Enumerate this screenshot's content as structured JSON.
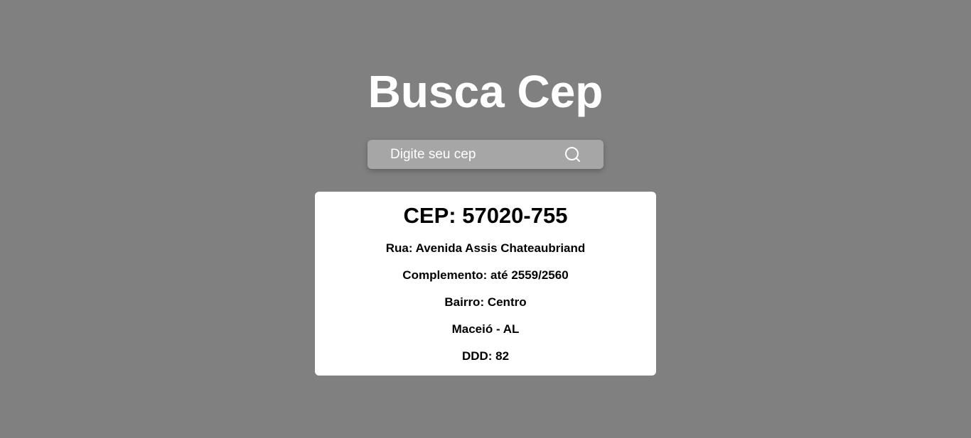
{
  "page": {
    "title": "Busca Cep"
  },
  "search": {
    "placeholder": "Digite seu cep",
    "value": "",
    "button_icon": "search-icon"
  },
  "result": {
    "cep_line": "CEP: 57020-755",
    "rua_line": "Rua: Avenida Assis Chateaubriand",
    "complemento_line": "Complemento: até 2559/2560",
    "bairro_line": "Bairro: Centro",
    "cidade_uf_line": "Maceió - AL",
    "ddd_line": "DDD: 82"
  },
  "colors": {
    "background": "#808080",
    "search_box": "#a6a6a6",
    "card": "#ffffff",
    "title_text": "#ffffff",
    "card_text": "#000000"
  }
}
